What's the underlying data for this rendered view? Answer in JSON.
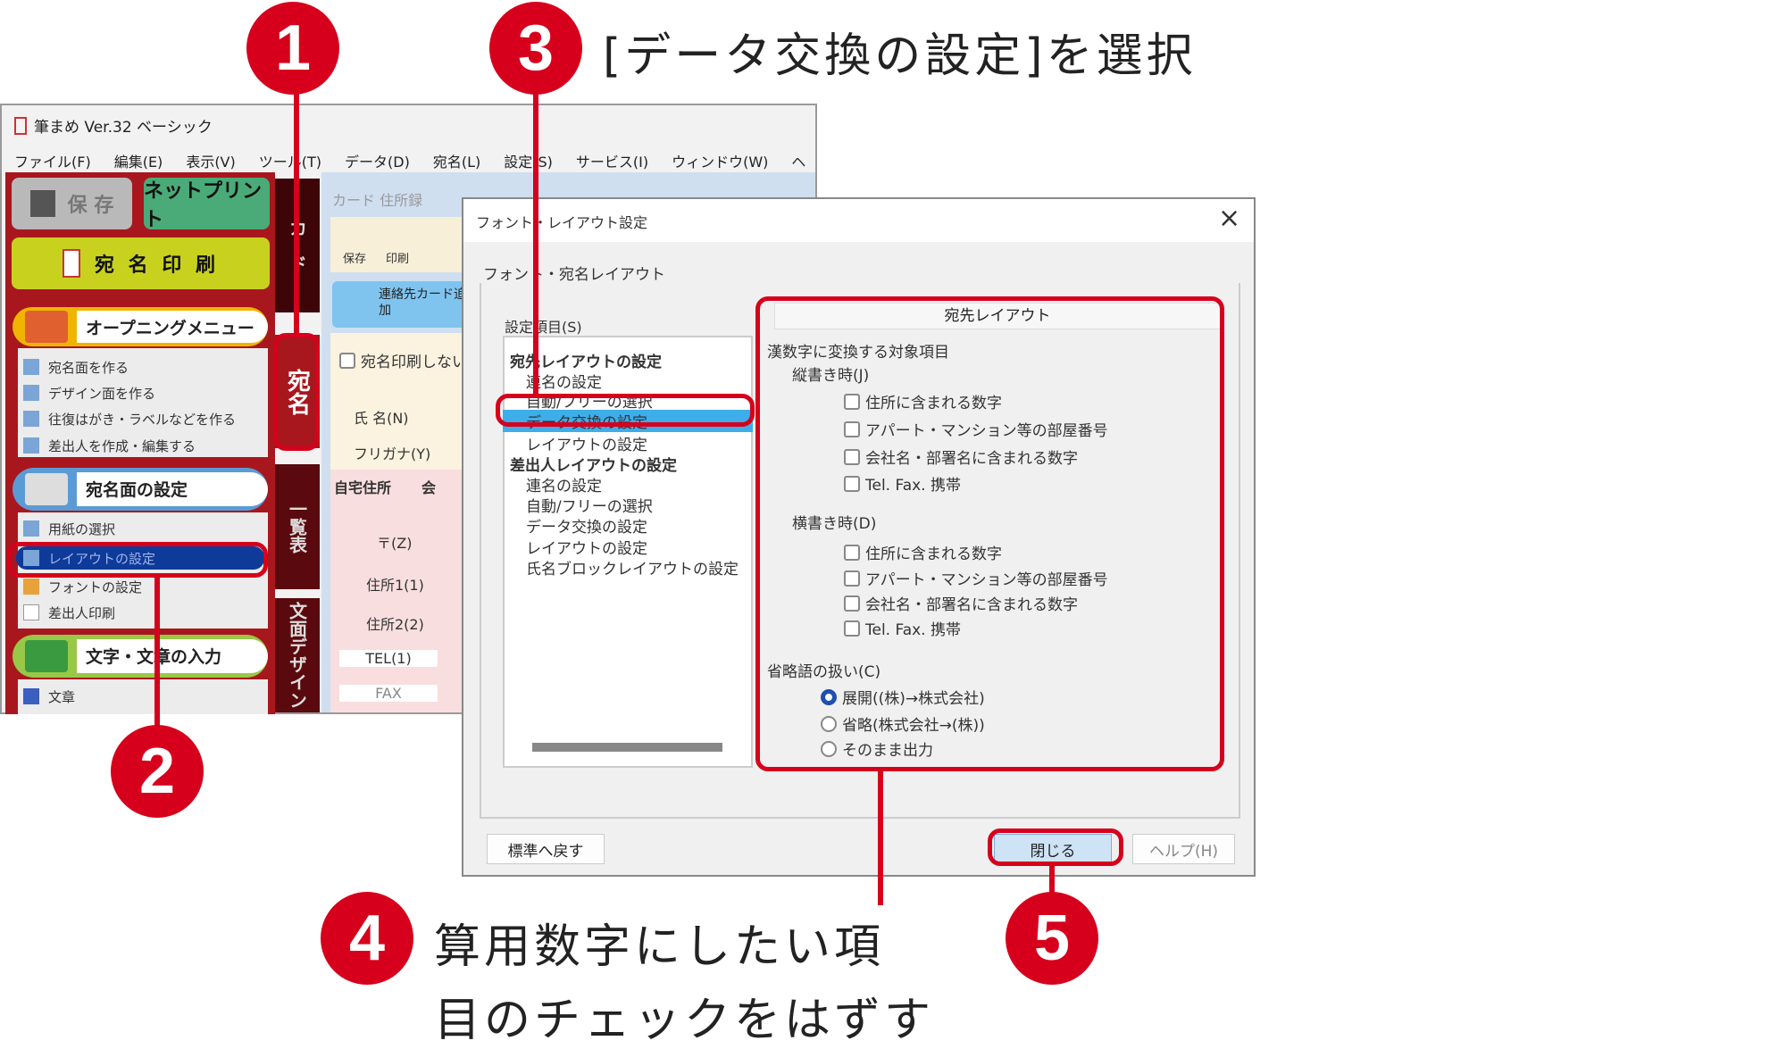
{
  "callouts": {
    "c1": "1",
    "c2": "2",
    "c3": "3",
    "c4": "4",
    "c5": "5"
  },
  "instructions": {
    "step3": "[データ交換の設定]を選択",
    "step4_line1": "算用数字にしたい項",
    "step4_line2": "目のチェックをはずす"
  },
  "colors": {
    "callout": "#d7001c",
    "sidebar": "#a8171e",
    "selected_sidebar": "#0e3a9a",
    "selected_list": "#3daee9"
  },
  "app": {
    "title": "筆まめ Ver.32 ベーシック",
    "menu": [
      "ファイル(F)",
      "編集(E)",
      "表示(V)",
      "ツール(T)",
      "データ(D)",
      "宛名(L)",
      "設定(S)",
      "サービス(I)",
      "ウィンドウ(W)",
      "ヘルプ(H)"
    ],
    "sidebar": {
      "save": "保 存",
      "netprint": "ネットプリント",
      "print": "宛 名 印 刷",
      "opening": "オープニングメニュー",
      "opening_items": [
        "宛名面を作る",
        "デザイン面を作る",
        "往復はがき・ラベルなどを作る",
        "差出人を作成・編集する"
      ],
      "address_settings": "宛名面の設定",
      "address_items": [
        "用紙の選択",
        "レイアウトの設定",
        "フォントの設定",
        "差出人印刷"
      ],
      "text_input": "文字・文章の入力",
      "text_items": [
        "文章"
      ]
    },
    "vtabs": {
      "top": "カード",
      "atena": "宛名",
      "list": "一覧表",
      "design": "文面デザイン"
    },
    "card": {
      "header": "カード 住所録",
      "tb_save": "保存",
      "tb_print": "印刷",
      "add_card": "連絡先カード追加",
      "no_print": "宛名印刷しない",
      "fields": [
        "氏 名(N)",
        "フリガナ(Y)",
        "〒(Z)",
        "住所1(1)",
        "住所2(2)",
        "TEL(1)",
        "FAX"
      ],
      "tab_home": "自宅住所",
      "tab_company": "会"
    }
  },
  "dialog": {
    "title": "フォント・レイアウト設定",
    "close": "×",
    "tab": "フォント・宛名レイアウト",
    "list_label": "設定項目(S)",
    "list": [
      {
        "t": "宛先レイアウトの設定",
        "h": true
      },
      {
        "t": "連名の設定"
      },
      {
        "t": "自動/フリーの選択"
      },
      {
        "t": "データ交換の設定",
        "sel": true
      },
      {
        "t": "レイアウトの設定"
      },
      {
        "t": "差出人レイアウトの設定",
        "h": true
      },
      {
        "t": "連名の設定"
      },
      {
        "t": "自動/フリーの選択"
      },
      {
        "t": "データ交換の設定"
      },
      {
        "t": "レイアウトの設定"
      },
      {
        "t": "氏名ブロックレイアウトの設定"
      }
    ],
    "panel_title": "宛先レイアウト",
    "group": "漢数字に変換する対象項目",
    "vertical": "縦書き時(J)",
    "vertical_items": [
      "住所に含まれる数字",
      "アパート・マンション等の部屋番号",
      "会社名・部署名に含まれる数字",
      "Tel. Fax. 携帯"
    ],
    "horizontal": "横書き時(D)",
    "horizontal_items": [
      "住所に含まれる数字",
      "アパート・マンション等の部屋番号",
      "会社名・部署名に含まれる数字",
      "Tel. Fax. 携帯"
    ],
    "abbr": "省略語の扱い(C)",
    "abbr_options": [
      "展開((株)→株式会社)",
      "省略(株式会社→(株))",
      "そのまま出力"
    ],
    "abbr_selected": 0,
    "reset": "標準へ戻す",
    "close_btn": "閉じる",
    "help": "ヘルプ(H)"
  }
}
